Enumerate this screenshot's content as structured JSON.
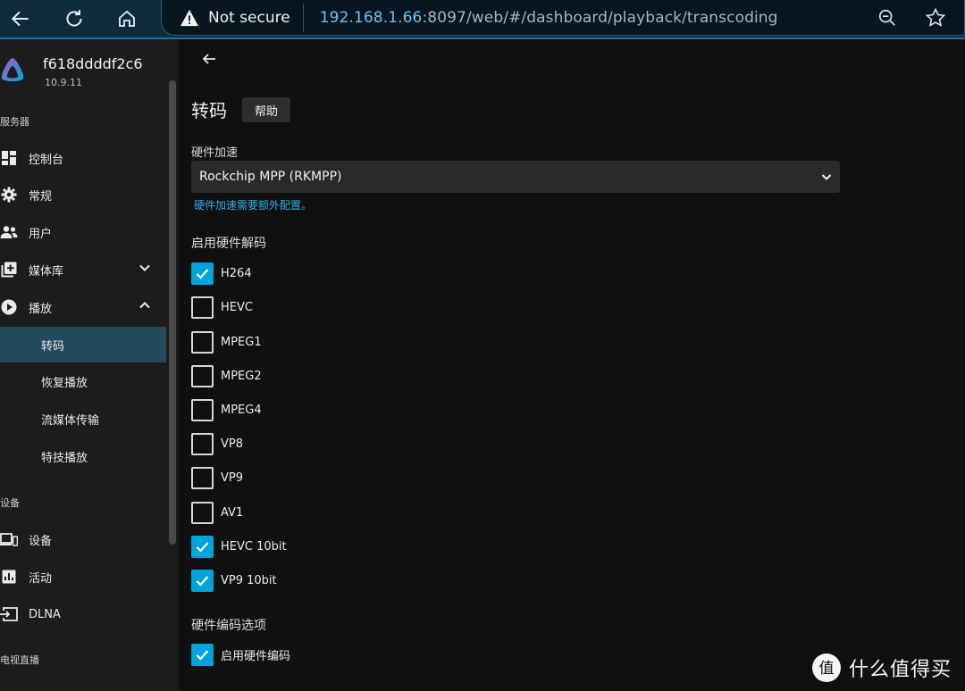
{
  "browser": {
    "security_label": "Not secure",
    "url_host": "192.168.1.66",
    "url_path": ":8097/web/#/dashboard/playback/transcoding"
  },
  "sidebar": {
    "server_name": "f618ddddf2c6",
    "server_version": "10.9.11",
    "sections": {
      "server": "服务器",
      "devices": "设备",
      "live_tv": "电视直播"
    },
    "items": [
      {
        "label": "控制台",
        "icon": "dashboard-icon"
      },
      {
        "label": "常规",
        "icon": "gear-icon"
      },
      {
        "label": "用户",
        "icon": "users-icon"
      },
      {
        "label": "媒体库",
        "icon": "library-add-icon"
      },
      {
        "label": "播放",
        "icon": "play-circle-icon"
      }
    ],
    "sub_items": [
      "转码",
      "恢复播放",
      "流媒体传输",
      "特技播放"
    ],
    "device_items": [
      {
        "label": "设备",
        "icon": "devices-icon"
      },
      {
        "label": "活动",
        "icon": "activity-icon"
      },
      {
        "label": "DLNA",
        "icon": "dlna-icon"
      }
    ]
  },
  "main": {
    "title": "转码",
    "help_label": "帮助",
    "hw_accel_label": "硬件加速",
    "hw_accel_value": "Rockchip MPP (RKMPP)",
    "hw_accel_hint": "硬件加速需要额外配置。",
    "decode_title": "启用硬件解码",
    "decoders": [
      {
        "label": "H264",
        "checked": true
      },
      {
        "label": "HEVC",
        "checked": false
      },
      {
        "label": "MPEG1",
        "checked": false
      },
      {
        "label": "MPEG2",
        "checked": false
      },
      {
        "label": "MPEG4",
        "checked": false
      },
      {
        "label": "VP8",
        "checked": false
      },
      {
        "label": "VP9",
        "checked": false
      },
      {
        "label": "AV1",
        "checked": false
      },
      {
        "label": "HEVC 10bit",
        "checked": true
      },
      {
        "label": "VP9 10bit",
        "checked": true
      }
    ],
    "encode_title": "硬件编码选项",
    "encode_option": {
      "label": "启用硬件编码",
      "checked": true
    }
  },
  "watermark": {
    "text": "什么值得买"
  },
  "colors": {
    "accent": "#00a4dc",
    "link": "#2fb0e8",
    "sidebar_active": "#24485c"
  }
}
